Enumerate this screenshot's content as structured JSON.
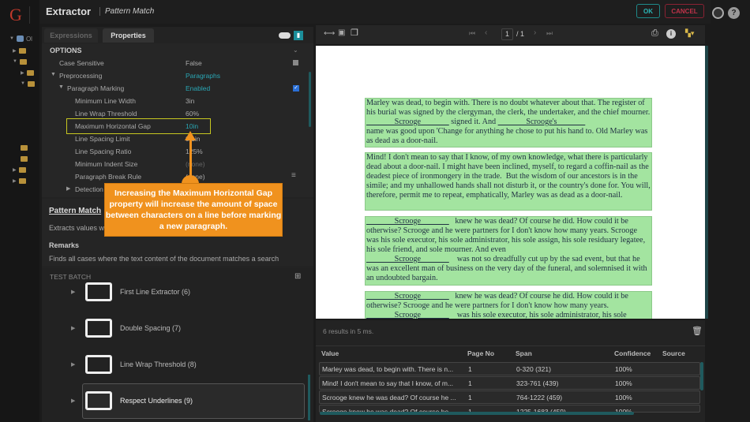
{
  "app": {
    "logo": "G",
    "title": "Extractor",
    "subtitle": "Pattern Match",
    "ok": "OK",
    "cancel": "CANCEL",
    "help": "?"
  },
  "tree": {
    "root": "Ol"
  },
  "tabs": [
    "Expressions",
    "Properties"
  ],
  "options": {
    "heading": "OPTIONS",
    "rows": [
      {
        "label": "Case Sensitive",
        "value": "False"
      },
      {
        "label": "Preprocessing",
        "value": "Paragraphs"
      },
      {
        "label": "Paragraph Marking",
        "value": "Enabled"
      },
      {
        "label": "Minimum Line Width",
        "value": "3in"
      },
      {
        "label": "Line Wrap Threshold",
        "value": "60%"
      },
      {
        "label": "Maximum Horizontal Gap",
        "value": "10in"
      },
      {
        "label": "Line Spacing Limit",
        "value": "0.1in"
      },
      {
        "label": "Line Spacing Ratio",
        "value": "125%"
      },
      {
        "label": "Minimum Indent Size",
        "value": "(none)"
      },
      {
        "label": "Paragraph Break Rule",
        "value": "(none)"
      },
      {
        "label": "Detection",
        "value": ""
      }
    ]
  },
  "description": {
    "title": "Pattern Match",
    "text": "Extracts values w",
    "remarks_heading": "Remarks",
    "remarks": "Finds all cases where the text content of the document matches a search"
  },
  "callout": "Increasing the Maximum Horizontal Gap property will increase the amount of space between characters on a line before marking a new paragraph.",
  "batch": {
    "heading": "TEST BATCH",
    "items": [
      "First Line Extractor (6)",
      "Double Spacing (7)",
      "Line Wrap Threshold (8)",
      "Respect Underlines (9)"
    ]
  },
  "viewer": {
    "page": "1",
    "total": "/ 1"
  },
  "document": {
    "paragraphs": [
      [
        "Marley was dead, to begin with. There is no doubt whatever about that. The register of his burial was signed by the clergyman, the clerk, the undertaker, and the chief mourner. ",
        "_______Scrooge_______",
        " signed it. And ",
        "_______Scrooge's_______",
        "\nname was good upon 'Change for anything he chose to put his hand to. Old Marley was as dead as a door-nail."
      ],
      [
        "Mind! I don't mean to say that I know, of my own knowledge, what there is particularly dead about a door-nail. I might have been inclined, myself, to regard a coffin-nail as the deadest piece of ironmongery in the trade.  But the wisdom of our ancestors is in the simile; and my unhallowed hands shall not disturb it, or the country's done for. You will, therefore, permit me to repeat, emphatically, Marley was as dead as a door-nail."
      ],
      [
        "",
        "_______Scrooge_______",
        "   knew he was dead? Of course he did. How could it be otherwise? Scrooge and he were partners for I don't know how many years. Scrooge was his sole executor, his sole administrator, his sole assign, his sole residuary legatee, his sole friend, and sole mourner. And even\n",
        "_______Scrooge_______",
        "    was not so dreadfully cut up by the sad event, but that he was an excellent man of business on the very day of the funeral, and solemnised it with an undoubted bargain."
      ],
      [
        "",
        "_______Scrooge_______",
        "   knew he was dead? Of course he did. How could it be otherwise? Scrooge and he were partners for I don't know how many years.\n",
        "_______Scrooge_______",
        "    was his sole executor, his sole administrator, his sole"
      ]
    ]
  },
  "results": {
    "summary": "6 results in 5 ms.",
    "columns": [
      "Value",
      "Page No",
      "Span",
      "Confidence",
      "Source"
    ],
    "rows": [
      [
        "Marley was dead, to begin with. There is n...",
        "1",
        "0-320 (321)",
        "100%",
        ""
      ],
      [
        "Mind! I don't mean to say that I know, of m...",
        "1",
        "323-761 (439)",
        "100%",
        ""
      ],
      [
        "Scrooge knew he was dead? Of course he ...",
        "1",
        "764-1222 (459)",
        "100%",
        ""
      ],
      [
        "Scrooge knew he was dead? Of course he ...",
        "1",
        "1225-1683 (459)",
        "100%",
        ""
      ]
    ]
  }
}
